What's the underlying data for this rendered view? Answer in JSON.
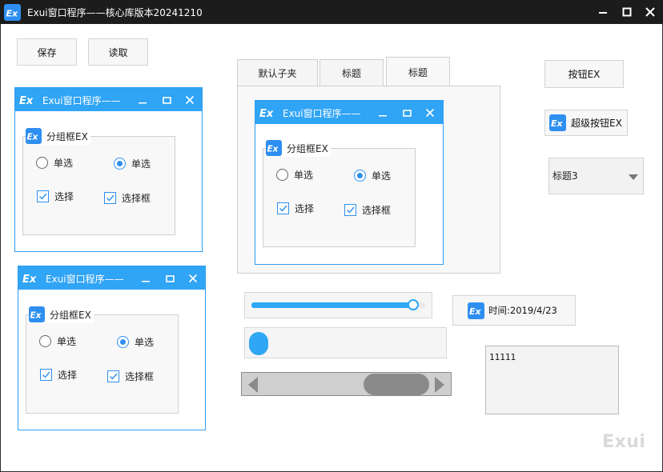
{
  "window": {
    "title": "Exui窗口程序——核心库版本20241210",
    "logo_text": "Ex"
  },
  "buttons": {
    "save": "保存",
    "read": "读取",
    "button_ex": "按钮EX",
    "super_button": "超级按钮EX"
  },
  "sub_windows": [
    {
      "title": "Exui窗口程序——",
      "group_caption": "分组框EX",
      "radio1": "单选",
      "radio2": "单选",
      "check1": "选择",
      "check2": "选择框"
    },
    {
      "title": "Exui窗口程序——",
      "group_caption": "分组框EX",
      "radio1": "单选",
      "radio2": "单选",
      "check1": "选择",
      "check2": "选择框"
    },
    {
      "title": "Exui窗口程序——",
      "group_caption": "分组框EX",
      "radio1": "单选",
      "radio2": "单选",
      "check1": "选择",
      "check2": "选择框"
    }
  ],
  "tabs": [
    "默认子夹",
    "标题",
    "标题"
  ],
  "active_tab": 2,
  "combo": {
    "value": "标题3"
  },
  "time_label": {
    "text": "时间:2019/4/23"
  },
  "slider": {
    "value_fraction": 0.93
  },
  "memo": {
    "text": "11111"
  },
  "watermark": "Exui",
  "colors": {
    "accent": "#2e8ff0",
    "subwin_title": "#30a4f5",
    "main_titlebar": "#1c1c1c"
  }
}
